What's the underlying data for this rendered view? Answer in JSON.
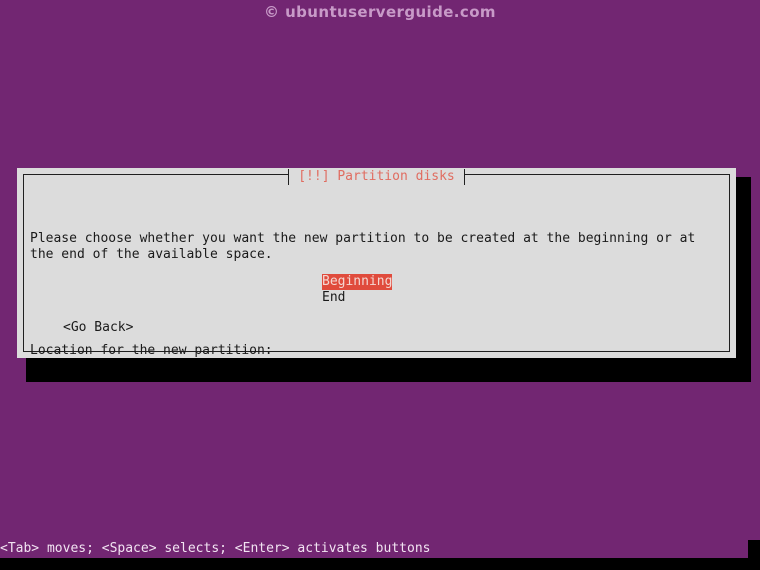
{
  "watermark": {
    "text": "© ubuntuserverguide.com"
  },
  "dialog": {
    "title": "[!!] Partition disks",
    "paragraph": "Please choose whether you want the new partition to be created at the beginning or at the end of the available space.",
    "prompt": "Location for the new partition:",
    "options": [
      {
        "label": "Beginning",
        "selected": true
      },
      {
        "label": "End",
        "selected": false
      }
    ],
    "go_back_label": "<Go Back>"
  },
  "statusbar": {
    "text": "<Tab> moves; <Space> selects; <Enter> activates buttons"
  },
  "colors": {
    "background": "#722672",
    "dialog_background": "#dcdcdc",
    "title": "#e06c60",
    "highlight_background": "#e04b3c",
    "highlight_text": "#f4d7d2",
    "status_text": "#f2e4f2",
    "shadow": "#000000"
  }
}
